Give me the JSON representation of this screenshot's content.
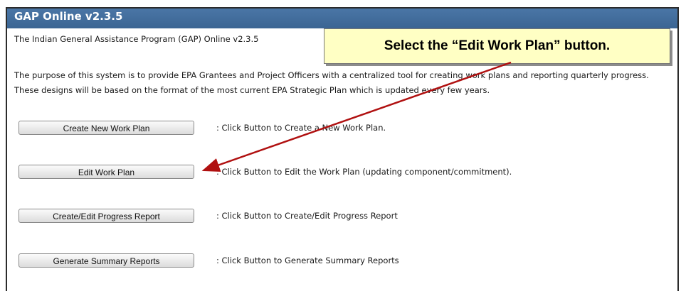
{
  "app": {
    "title": "GAP Online v2.3.5",
    "intro": "The Indian General Assistance Program (GAP) Online v2.3.5",
    "purpose": "The purpose of this system is to provide EPA Grantees and Project Officers with a centralized tool for creating work plans and reporting quarterly progress. These designs will be based on the format of the most current EPA Strategic Plan which is updated every few years."
  },
  "actions": [
    {
      "button": "Create New Work Plan",
      "description": ": Click Button to Create a New Work Plan."
    },
    {
      "button": "Edit Work Plan",
      "description": ": Click Button to Edit the Work Plan (updating component/commitment)."
    },
    {
      "button": "Create/Edit Progress Report",
      "description": ": Click Button to Create/Edit Progress Report"
    },
    {
      "button": "Generate Summary Reports",
      "description": ": Click Button to Generate Summary Reports"
    }
  ],
  "callout": {
    "text": "Select the “Edit Work Plan” button."
  },
  "colors": {
    "header": "#3b6593",
    "callout_bg": "#ffffc4",
    "arrow": "#b01010"
  }
}
